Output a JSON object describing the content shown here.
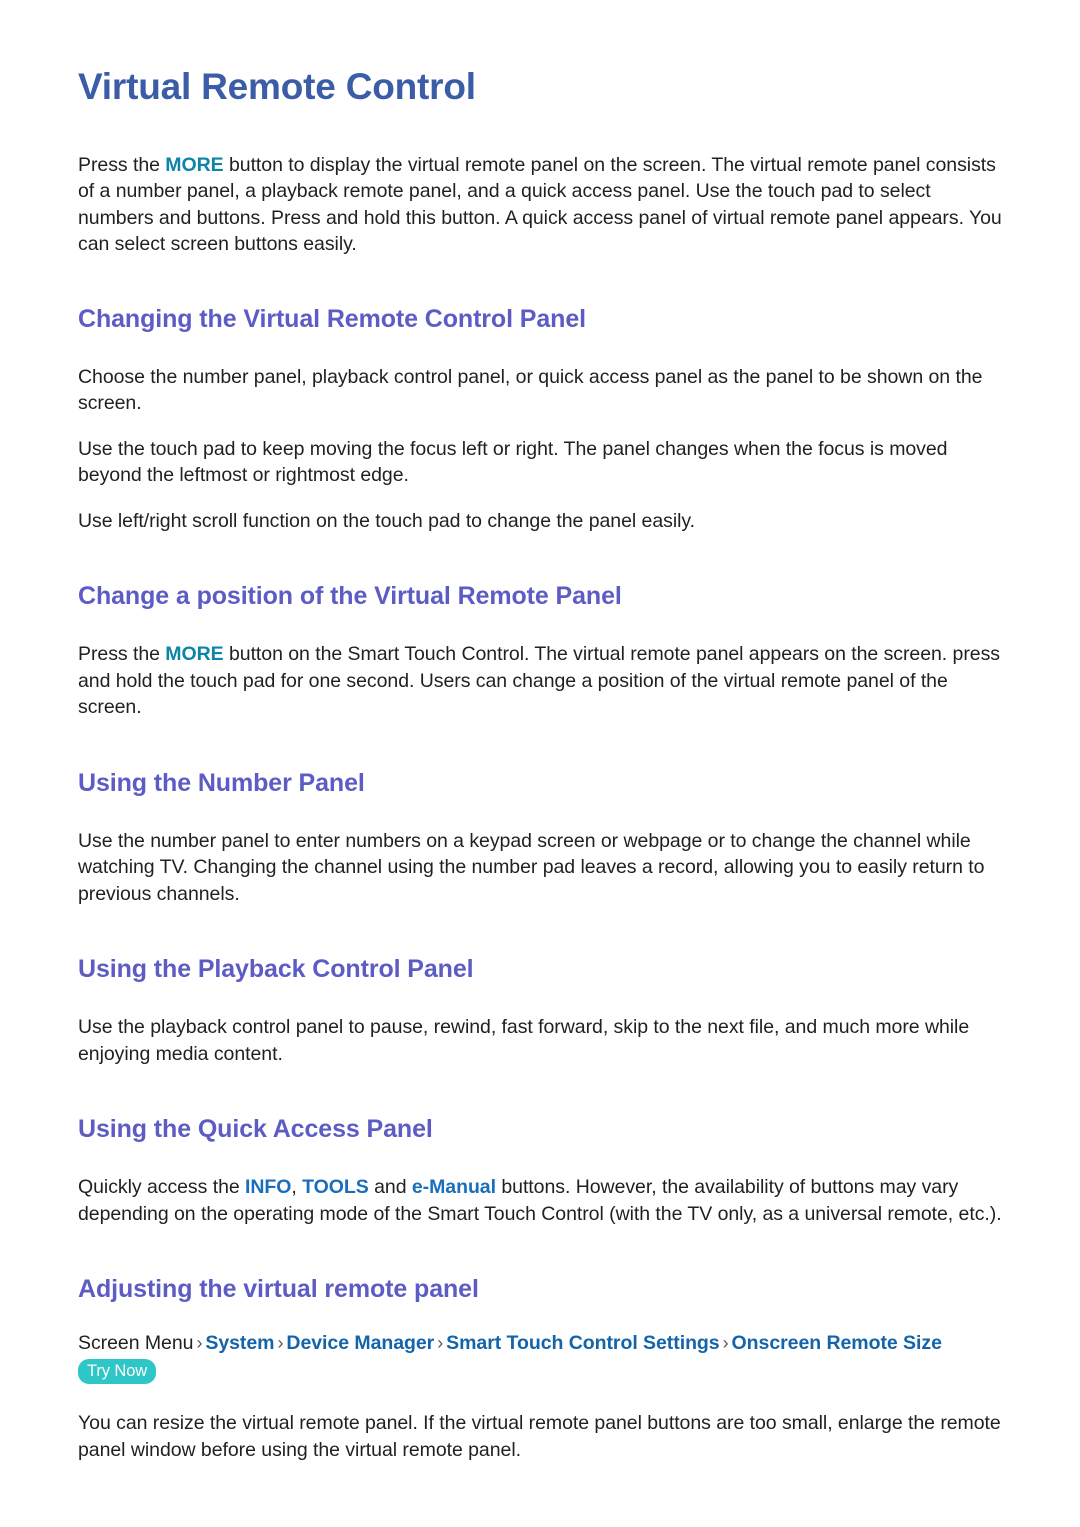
{
  "document": {
    "title": "Virtual Remote Control",
    "colors": {
      "title": "#3b5ca6",
      "heading": "#5c5cc4",
      "body": "#231f20",
      "inline_more": "#0d84a8",
      "inline_button": "#1a6fbd",
      "breadcrumb_link": "#1464aa",
      "try_now_badge_bg": "#2ec6c6",
      "try_now_badge_text": "#ffffff",
      "page_background": "#ffffff"
    }
  },
  "intro": {
    "part1": "Press the ",
    "token_more": "MORE",
    "part2": " button to display the virtual remote panel on the screen. The virtual remote panel consists of a number panel, a playback remote panel, and a quick access panel. Use the touch pad to select numbers and buttons. Press and hold this button. A quick access panel of virtual remote panel appears. You can select screen buttons easily."
  },
  "sections": [
    {
      "heading": "Changing the Virtual Remote Control Panel",
      "paragraphs": [
        "Choose the number panel, playback control panel, or quick access panel as the panel to be shown on the screen.",
        "Use the touch pad to keep moving the focus left or right. The panel changes when the focus is moved beyond the leftmost or rightmost edge.",
        "Use left/right scroll function on the touch pad to change the panel easily."
      ]
    },
    {
      "heading": "Change a position of the Virtual Remote Panel",
      "paragraph_part1": "Press the ",
      "token_more": "MORE",
      "paragraph_part2": " button on the Smart Touch Control. The virtual remote panel appears on the screen. press and hold the touch pad for one second. Users can change a position of the virtual remote panel of the screen."
    },
    {
      "heading": "Using the Number Panel",
      "paragraphs": [
        "Use the number panel to enter numbers on a keypad screen or webpage or to change the channel while watching TV. Changing the channel using the number pad leaves a record, allowing you to easily return to previous channels."
      ]
    },
    {
      "heading": "Using the Playback Control Panel",
      "paragraphs": [
        "Use the playback control panel to pause, rewind, fast forward, skip to the next file, and much more while enjoying media content."
      ]
    },
    {
      "heading": "Using the Quick Access Panel",
      "paragraph_part1": "Quickly access the ",
      "token_info": "INFO",
      "paragraph_sep1": ", ",
      "token_tools": "TOOLS",
      "paragraph_sep2": " and ",
      "token_emanual": "e-Manual",
      "paragraph_part2": " buttons. However, the availability of buttons may vary depending on the operating mode of the Smart Touch Control (with the TV only, as a universal remote, etc.)."
    },
    {
      "heading": "Adjusting the virtual remote panel",
      "breadcrumb": {
        "root": "Screen Menu",
        "separator": "›",
        "items": [
          "System",
          "Device Manager",
          "Smart Touch Control Settings",
          "Onscreen Remote Size"
        ],
        "badge": "Try Now"
      },
      "paragraphs": [
        "You can resize the virtual remote panel. If the virtual remote panel buttons are too small, enlarge the remote panel window before using the virtual remote panel."
      ]
    }
  ]
}
